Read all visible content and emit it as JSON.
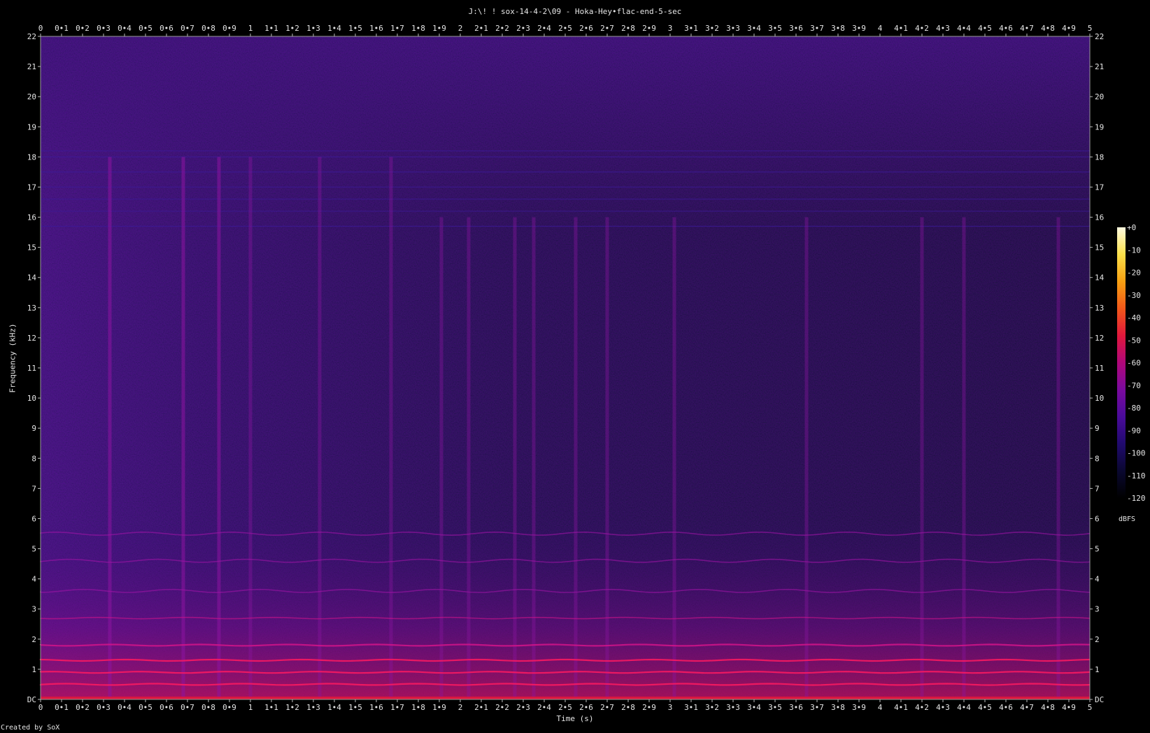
{
  "title": "J:\\! ! sox-14-4-2\\09 - Hoka-Hey•flac-end-5-sec",
  "credit": "Created by SoX",
  "colorbar_label": "dBFS",
  "colors": {
    "background": "#000000",
    "text": "#e6e6e6",
    "colormap": [
      "#000000",
      "#0a0830",
      "#200a6e",
      "#4a0b9a",
      "#7a0a9e",
      "#b0077a",
      "#e0183c",
      "#f2581a",
      "#f7a012",
      "#fbe04a",
      "#fffbe0"
    ]
  },
  "chart_data": {
    "type": "heatmap",
    "title": "J:\\! ! sox-14-4-2\\09 - Hoka-Hey•flac-end-5-sec",
    "xlabel": "Time (s)",
    "ylabel": "Frequency (kHz)",
    "xlim": [
      0,
      5
    ],
    "ylim": [
      0,
      22
    ],
    "x_ticks": [
      "0",
      "0•1",
      "0•2",
      "0•3",
      "0•4",
      "0•5",
      "0•6",
      "0•7",
      "0•8",
      "0•9",
      "1",
      "1•1",
      "1•2",
      "1•3",
      "1•4",
      "1•5",
      "1•6",
      "1•7",
      "1•8",
      "1•9",
      "2",
      "2•1",
      "2•2",
      "2•3",
      "2•4",
      "2•5",
      "2•6",
      "2•7",
      "2•8",
      "2•9",
      "3",
      "3•1",
      "3•2",
      "3•3",
      "3•4",
      "3•5",
      "3•6",
      "3•7",
      "3•8",
      "3•9",
      "4",
      "4•1",
      "4•2",
      "4•3",
      "4•4",
      "4•5",
      "4•6",
      "4•7",
      "4•8",
      "4•9",
      "5"
    ],
    "y_ticks": [
      "DC",
      "1",
      "2",
      "3",
      "4",
      "5",
      "6",
      "7",
      "8",
      "9",
      "10",
      "11",
      "12",
      "13",
      "14",
      "15",
      "16",
      "17",
      "18",
      "19",
      "20",
      "21",
      "22"
    ],
    "colorbar": {
      "label": "dBFS",
      "ticks": [
        "+0",
        "-10",
        "-20",
        "-30",
        "-40",
        "-50",
        "-60",
        "-70",
        "-80",
        "-90",
        "-100",
        "-110",
        "-120"
      ],
      "range": [
        -120,
        0
      ]
    },
    "harmonic_lines_khz": [
      0.5,
      0.9,
      1.3,
      1.8,
      2.7,
      3.6,
      4.6,
      5.5
    ],
    "transients_s": [
      0.33,
      0.68,
      0.85,
      1.0,
      1.33,
      1.67,
      1.91,
      2.04,
      2.26,
      2.35,
      2.55,
      2.7,
      3.02,
      3.65,
      4.2,
      4.4,
      4.85
    ],
    "upper_bands_khz": [
      15.7,
      16.2,
      16.6,
      17.0,
      17.5,
      18.0,
      18.2
    ]
  }
}
